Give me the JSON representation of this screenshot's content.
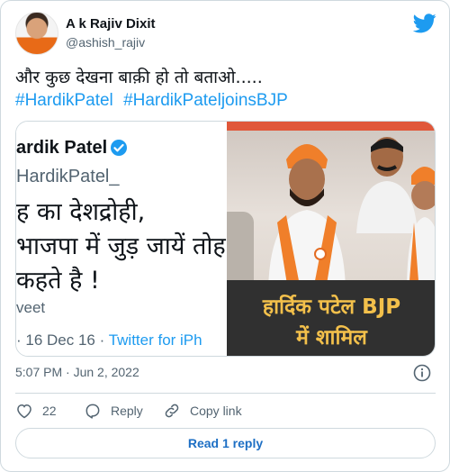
{
  "author": {
    "name": "A k Rajiv Dixit",
    "handle": "@ashish_rajiv"
  },
  "tweet": {
    "text": "और कुछ देखना बाक़ी हो तो बताओ.....",
    "hashtags": [
      "#HardikPatel",
      "#HardikPateljoinsBJP"
    ]
  },
  "media": {
    "left": {
      "name": "ardik Patel",
      "handle": "HardikPatel_",
      "lines": [
        "ह का देशद्रोही,",
        "भाजपा में जुड़ जायें तोह",
        "कहते है !"
      ],
      "tweet_label": "veet",
      "date": "· 16 Dec 16 ·",
      "source": "Twitter for iPh"
    },
    "right": {
      "caption_line1": "हार्दिक पटेल BJP",
      "caption_line2": "में शामिल"
    }
  },
  "timestamp": "5:07 PM · Jun 2, 2022",
  "actions": {
    "likes": "22",
    "reply": "Reply",
    "copy": "Copy link"
  },
  "read_replies": "Read 1 reply",
  "colors": {
    "accent": "#1d9bf0",
    "text": "#0f1419",
    "muted": "#536471",
    "border": "#cfd9de",
    "heart": "#536471"
  }
}
